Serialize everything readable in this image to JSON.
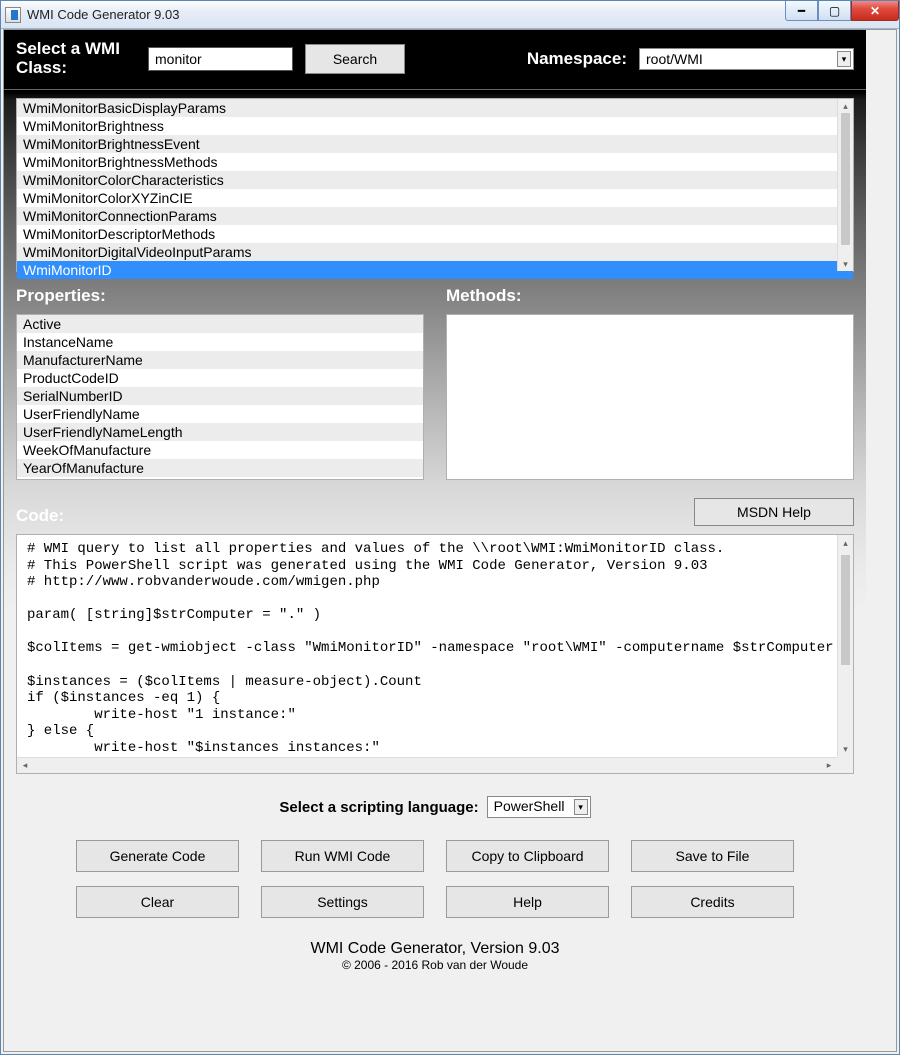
{
  "window": {
    "title": "WMI Code Generator 9.03"
  },
  "top": {
    "select_class_label": "Select a WMI Class:",
    "search_value": "monitor",
    "search_button": "Search",
    "namespace_label": "Namespace:",
    "namespace_value": "root/WMI"
  },
  "class_list": [
    "WmiMonitorBasicDisplayParams",
    "WmiMonitorBrightness",
    "WmiMonitorBrightnessEvent",
    "WmiMonitorBrightnessMethods",
    "WmiMonitorColorCharacteristics",
    "WmiMonitorColorXYZinCIE",
    "WmiMonitorConnectionParams",
    "WmiMonitorDescriptorMethods",
    "WmiMonitorDigitalVideoInputParams",
    "WmiMonitorID"
  ],
  "class_list_selected_index": 9,
  "section_labels": {
    "properties": "Properties:",
    "methods": "Methods:",
    "code": "Code:"
  },
  "properties": [
    "Active",
    "InstanceName",
    "ManufacturerName",
    "ProductCodeID",
    "SerialNumberID",
    "UserFriendlyName",
    "UserFriendlyNameLength",
    "WeekOfManufacture",
    "YearOfManufacture"
  ],
  "methods": [],
  "buttons": {
    "msdn_help": "MSDN  Help"
  },
  "code_text": "# WMI query to list all properties and values of the \\\\root\\WMI:WmiMonitorID class.\n# This PowerShell script was generated using the WMI Code Generator, Version 9.03\n# http://www.robvanderwoude.com/wmigen.php\n\nparam( [string]$strComputer = \".\" )\n\n$colItems = get-wmiobject -class \"WmiMonitorID\" -namespace \"root\\WMI\" -computername $strComputer\n\n$instances = ($colItems | measure-object).Count\nif ($instances -eq 1) {\n        write-host \"1 instance:\"\n} else {\n        write-host \"$instances instances:\"\n}",
  "lang_row": {
    "label": "Select a scripting language:",
    "value": "PowerShell"
  },
  "action_buttons": [
    "Generate Code",
    "Run WMI Code",
    "Copy to Clipboard",
    "Save to File",
    "Clear",
    "Settings",
    "Help",
    "Credits"
  ],
  "footer": {
    "line1": "WMI Code Generator,  Version 9.03",
    "line2": "© 2006 - 2016 Rob van der Woude"
  }
}
